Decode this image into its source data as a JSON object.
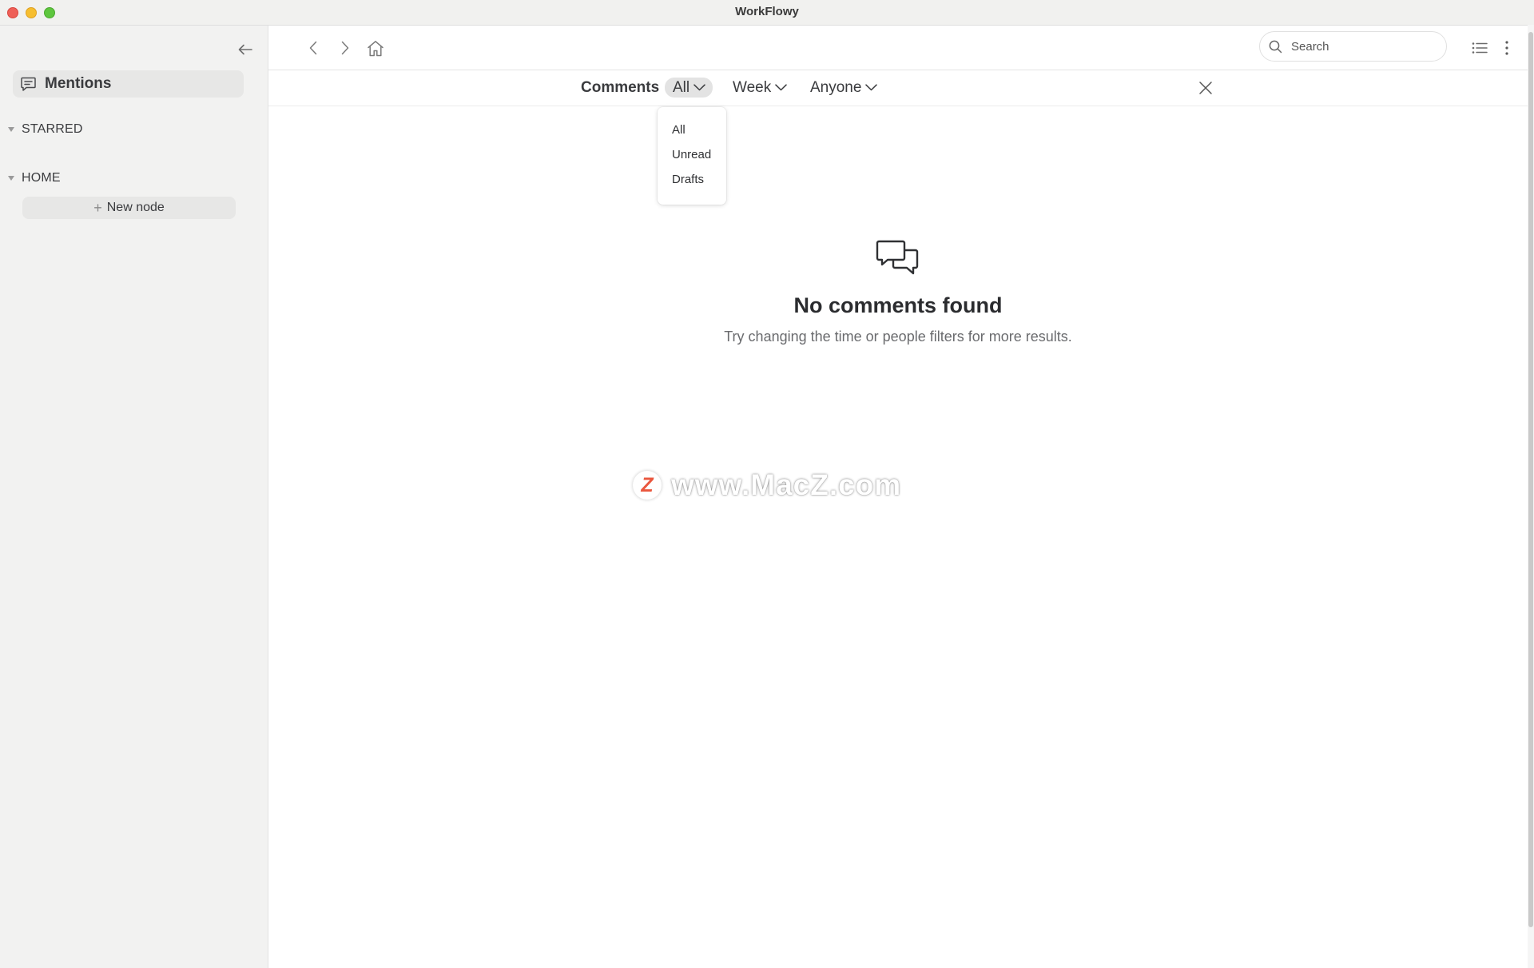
{
  "window": {
    "title": "WorkFlowy"
  },
  "sidebar": {
    "mentions_label": "Mentions",
    "sections": [
      {
        "label": "STARRED"
      },
      {
        "label": "HOME"
      }
    ],
    "new_node_label": "New node"
  },
  "toolbar": {
    "search_placeholder": "Search"
  },
  "filters": {
    "title": "Comments",
    "status": "All",
    "time": "Week",
    "people": "Anyone"
  },
  "status_menu": {
    "options": [
      "All",
      "Unread",
      "Drafts"
    ]
  },
  "empty_state": {
    "title": "No comments found",
    "subtitle": "Try changing the time or people filters for more results."
  },
  "watermark": {
    "logo": "Z",
    "text": "www.MacZ.com"
  },
  "icons": {
    "collapse": "arrow-left-icon",
    "mentions": "comment-icon",
    "back": "chevron-left-icon",
    "forward": "chevron-right-icon",
    "home": "home-icon",
    "search": "search-icon",
    "list": "list-icon",
    "more": "more-vertical-icon",
    "close": "close-icon",
    "empty": "chat-bubbles-icon"
  },
  "colors": {
    "sidebar_bg": "#f2f2f1",
    "selected_bg": "#e7e7e6",
    "text": "#2a2b2e",
    "muted": "#6a6b6e",
    "watermark_red": "#e8452a"
  }
}
